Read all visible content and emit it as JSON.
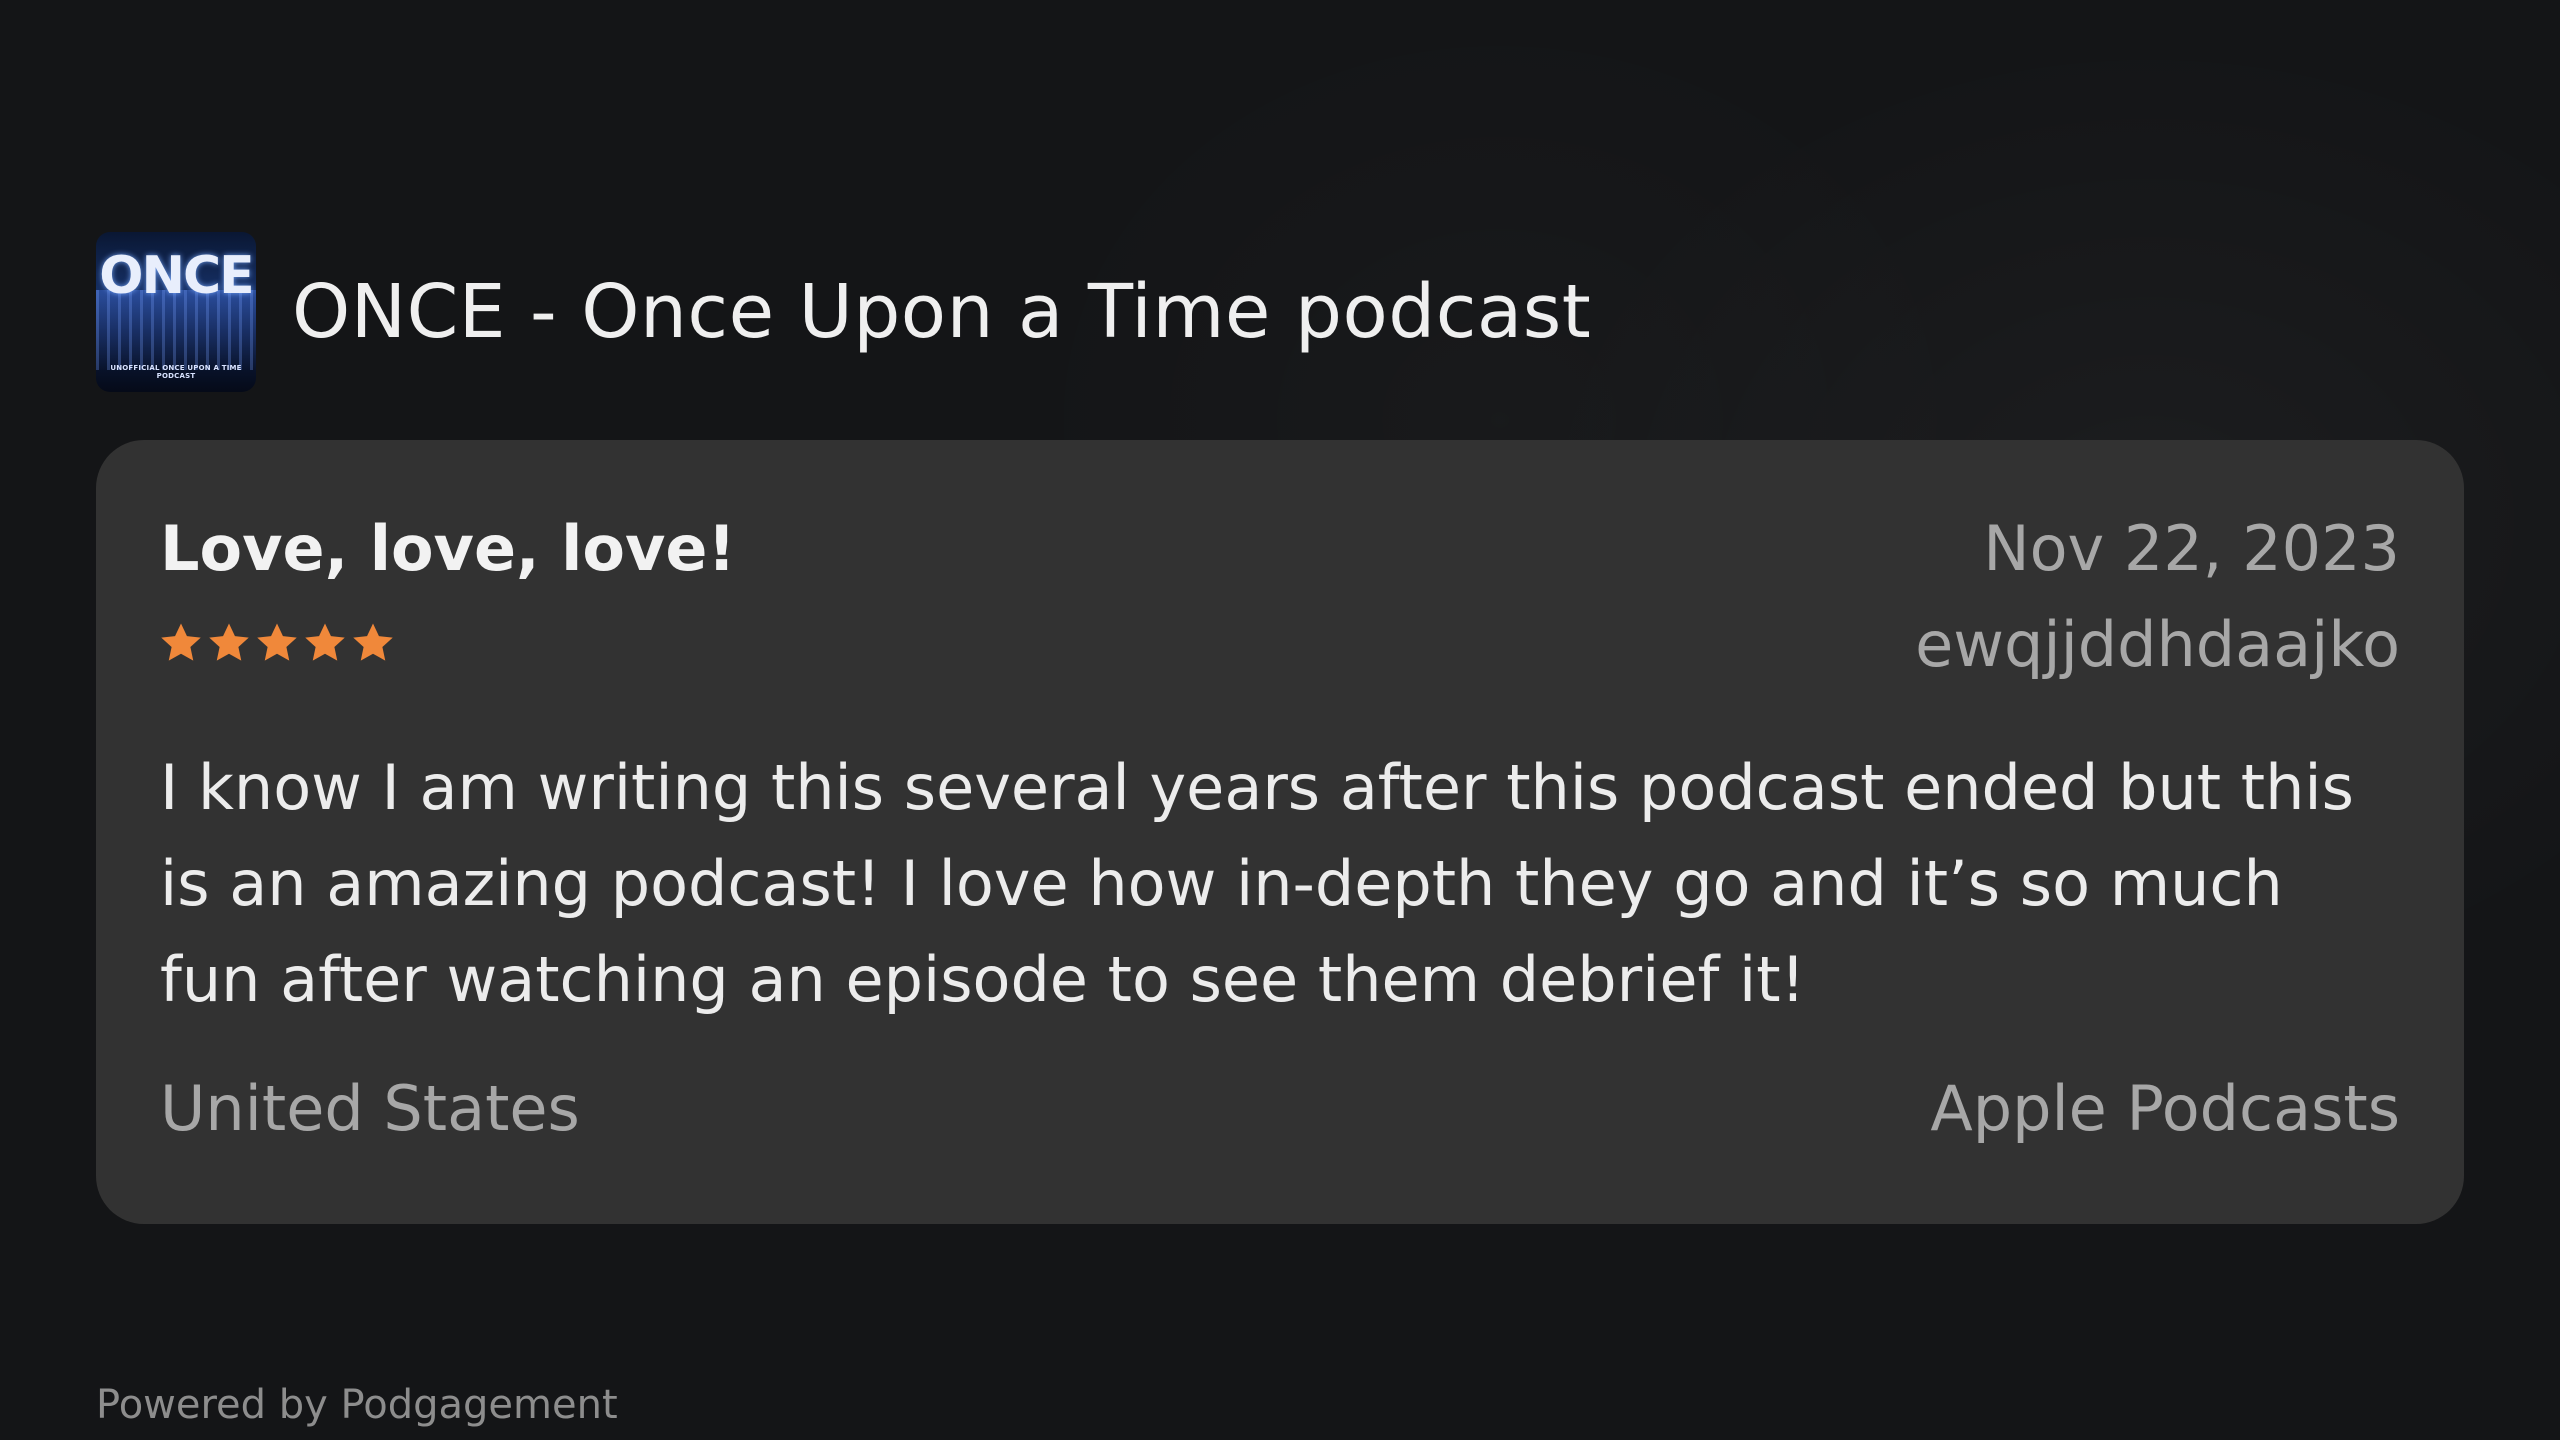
{
  "podcast": {
    "title": "ONCE - Once Upon a Time podcast",
    "cover_text": "ONCE",
    "cover_subtext": "UNOFFICIAL ONCE UPON A TIME PODCAST"
  },
  "review": {
    "title": "Love, love, love!",
    "date": "Nov 22, 2023",
    "author": "ewqjjddhdaajko",
    "rating": 5,
    "rating_max": 5,
    "star_color": "#f0883a",
    "body": "I know I am writing this several years after this podcast ended but this is an amazing podcast! I love how in-depth they go and it’s so much fun after watching an episode to see them debrief it!",
    "country": "United States",
    "platform": "Apple Podcasts"
  },
  "footer": {
    "text": "Powered by Podgagement"
  }
}
